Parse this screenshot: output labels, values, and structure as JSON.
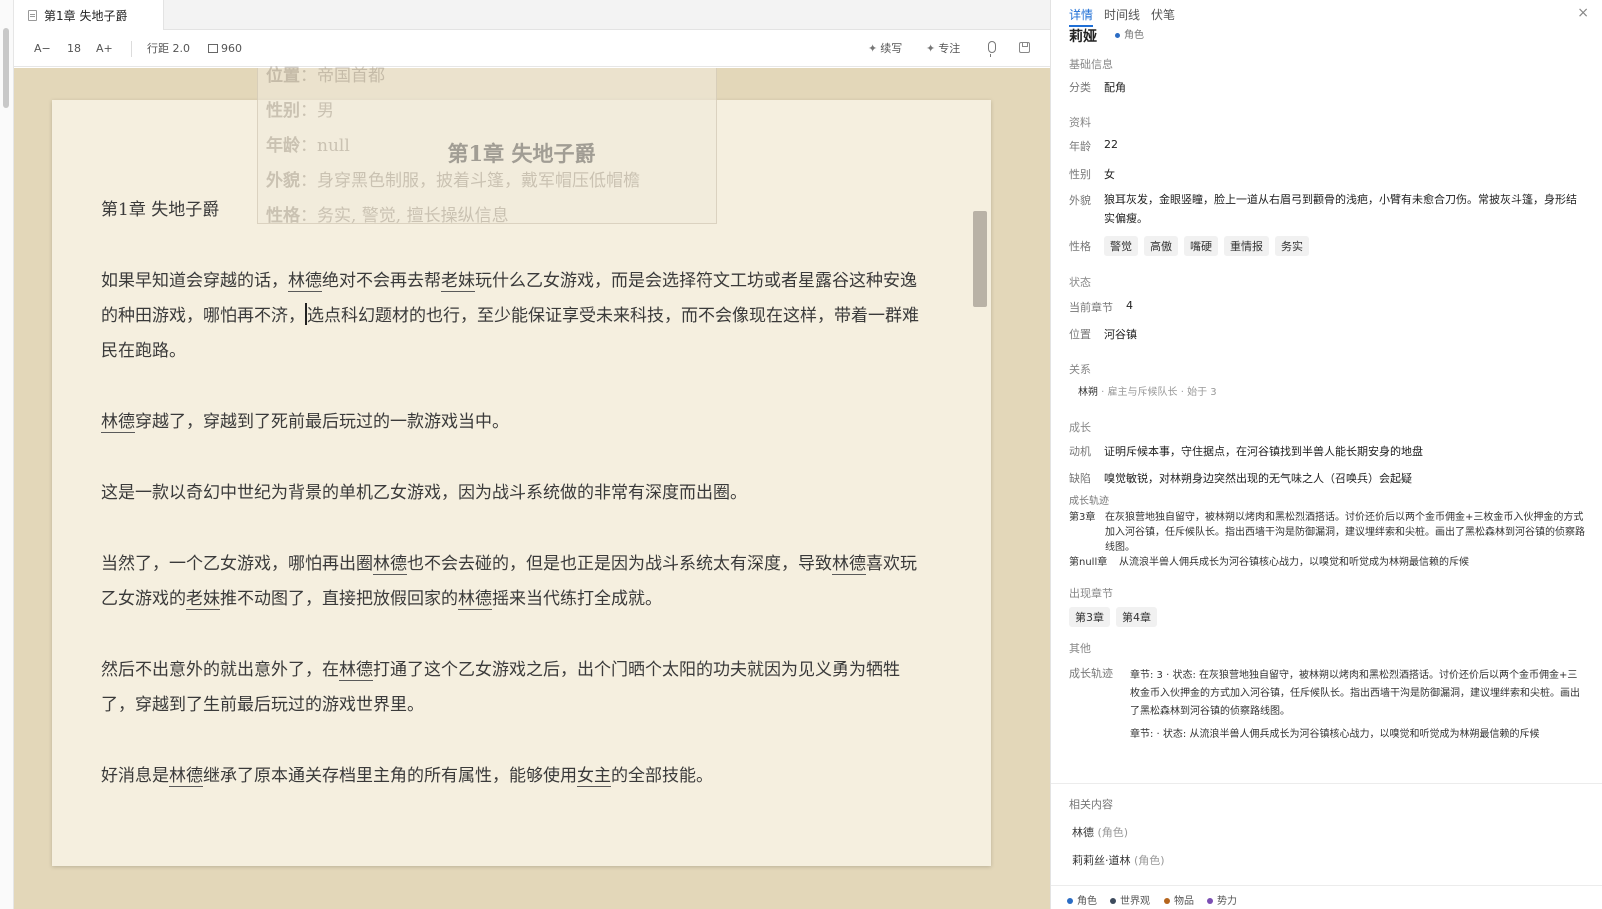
{
  "tab": {
    "title": "第1章 失地子爵"
  },
  "toolbar": {
    "font_dec": "A−",
    "font_size": "18",
    "font_inc": "A+",
    "line_height": "行距 2.0",
    "width": "960",
    "continue_label": "续写",
    "focus_label": "专注"
  },
  "editor": {
    "page_title": "第1章 失地子爵",
    "heading_line": "第1章 失地子爵",
    "p1": {
      "a": "如果早知道会穿越的话，",
      "e1": "林德",
      "b": "绝对不会再去帮",
      "e2": "老妹",
      "c": "玩什么乙女游戏，而是会选择符文工坊或者星露谷这种安逸的种田游戏，哪怕再不济，",
      "d": "选点科幻题材的也行，至少能保证享受未来科技，而不会像现在这样，带着一群难民在跑路。"
    },
    "p2": {
      "e1": "林德",
      "a": "穿越了，穿越到了死前最后玩过的一款游戏当中。"
    },
    "p3": "这是一款以奇幻中世纪为背景的单机乙女游戏，因为战斗系统做的非常有深度而出圈。",
    "p4": {
      "a": "当然了，一个乙女游戏，哪怕再出圈",
      "e1": "林德",
      "b": "也不会去碰的，但是也正是因为战斗系统太有深度，导致",
      "e2": "林德",
      "c": "喜欢玩乙女游戏的",
      "e3": "老妹",
      "d": "推不动图了，直接把放假回家的",
      "e4": "林德",
      "f": "摇来当代练打全成就。"
    },
    "p5": {
      "a": "然后不出意外的就出意外了，在",
      "e1": "林德",
      "b": "打通了这个乙女游戏之后，出个门晒个太阳的功夫就因为见义勇为牺牲了，穿越到了生前最后玩过的游戏世界里。"
    },
    "p6": {
      "a": "好消息是",
      "e1": "林德",
      "b": "继承了原本通关存档里主角的所有属性，能够使用",
      "e2": "女主",
      "c": "的全部技能。"
    },
    "ghost": {
      "r1k": "位置",
      "r1v": "：帝国首都",
      "r2k": "性别",
      "r2v": "：男",
      "r3k": "年龄",
      "r3v": "：null",
      "r4k": "外貌",
      "r4v": "：身穿黑色制服，披着斗篷，戴军帽压低帽檐",
      "r5k": "性格",
      "r5v": "：务实, 警觉, 擅长操纵信息"
    }
  },
  "panel": {
    "tabs": [
      "详情",
      "时间线",
      "伏笔"
    ],
    "close": "×",
    "name": "莉娅",
    "name_tag": "角色",
    "basic": {
      "title": "基础信息",
      "category_label": "分类",
      "category_value": "配角"
    },
    "profile": {
      "title": "资料",
      "age_label": "年龄",
      "age_value": "22",
      "gender_label": "性别",
      "gender_value": "女",
      "look_label": "外貌",
      "look_value": "狼耳灰发，金眼竖瞳，脸上一道从右眉弓到颧骨的浅疤，小臂有未愈合刀伤。常披灰斗篷，身形结实偏瘦。",
      "trait_label": "性格",
      "traits": [
        "警觉",
        "高傲",
        "嘴硬",
        "重情报",
        "务实"
      ]
    },
    "status": {
      "title": "状态",
      "chapter_label": "当前章节",
      "chapter_value": "4",
      "location_label": "位置",
      "location_value": "河谷镇"
    },
    "relations": {
      "title": "关系",
      "name": "林朔",
      "rel": "雇主与斥候队长",
      "since": "始于 3"
    },
    "growth": {
      "title": "成长",
      "motive_label": "动机",
      "motive_value": "证明斥候本事，守住据点，在河谷镇找到半兽人能长期安身的地盘",
      "flaw_label": "缺陷",
      "flaw_value": "嗅觉敏锐，对林朔身边突然出现的无气味之人（召唤兵）会起疑",
      "track_title": "成长轨迹",
      "track1_ch": "第3章",
      "track1_text": "在灰狼营地独自留守，被林朔以烤肉和黑松烈酒搭话。讨价还价后以两个金币佣金+三枚金币入伙押金的方式加入河谷镇，任斥候队长。指出西墙干沟是防御漏洞，建议埋绊索和尖桩。画出了黑松森林到河谷镇的侦察路线图。",
      "track2_ch": "第null章",
      "track2_text": "从流浪半兽人佣兵成长为河谷镇核心战力，以嗅觉和听觉成为林朔最信赖的斥候"
    },
    "appear": {
      "title": "出现章节",
      "chapters": [
        "第3章",
        "第4章"
      ]
    },
    "other": {
      "title": "其他",
      "label": "成长轨迹",
      "line1": "章节: 3 · 状态: 在灰狼营地独自留守，被林朔以烤肉和黑松烈酒搭话。讨价还价后以两个金币佣金+三枚金币入伙押金的方式加入河谷镇，任斥候队长。指出西墙干沟是防御漏洞，建议埋绊索和尖桩。画出了黑松森林到河谷镇的侦察路线图。",
      "line2": "章节: · 状态: 从流浪半兽人佣兵成长为河谷镇核心战力，以嗅觉和听觉成为林朔最信赖的斥候"
    },
    "related": {
      "title": "相关内容",
      "items": [
        {
          "name": "林德",
          "type": "(角色)"
        },
        {
          "name": "莉莉丝·道林",
          "type": "(角色)"
        }
      ]
    },
    "legend": [
      {
        "label": "角色",
        "color": "#2b6cc4"
      },
      {
        "label": "世界观",
        "color": "#3d4a5c"
      },
      {
        "label": "物品",
        "color": "#b5651d"
      },
      {
        "label": "势力",
        "color": "#7b4fb3"
      }
    ]
  }
}
